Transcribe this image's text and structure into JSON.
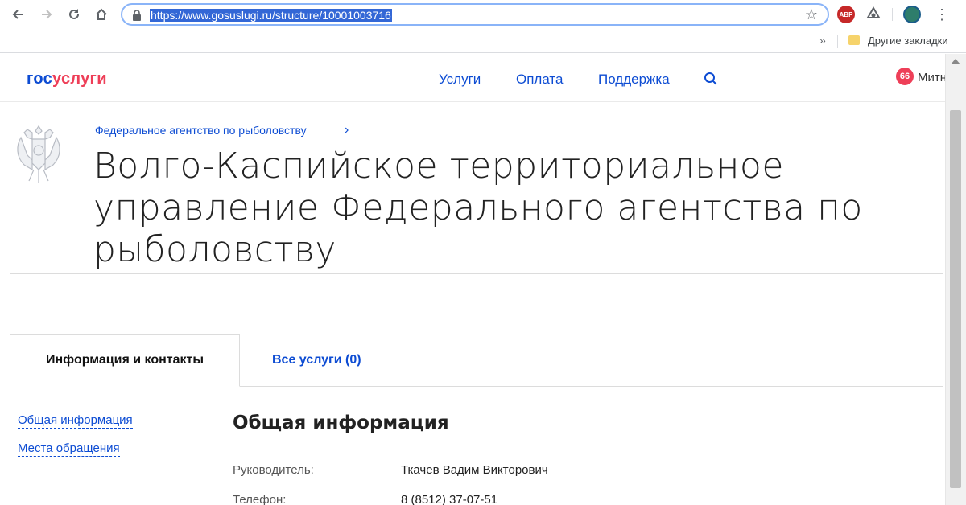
{
  "browser": {
    "url": "https://www.gosuslugi.ru/structure/10001003716",
    "bookmarks_more": "»",
    "bookmark_folder": "Другие закладки",
    "ext_abp": "ABP"
  },
  "header": {
    "logo_part1": "гос",
    "logo_part2": "услуги",
    "nav": [
      "Услуги",
      "Оплата",
      "Поддержка"
    ],
    "notifications": "66",
    "user_name": "Митн"
  },
  "breadcrumb": "Федеральное агентство по рыболовству",
  "title": "Волго-Каспийское территориальное управление Федерального агентства по рыболовству",
  "tabs": {
    "active": "Информация и контакты",
    "other": "Все услуги (0)"
  },
  "side_links": [
    "Общая информация",
    "Места обращения"
  ],
  "section": {
    "title": "Общая информация",
    "fields": [
      {
        "label": "Руководитель:",
        "value": "Ткачев Вадим Викторович"
      },
      {
        "label": "Телефон:",
        "value": "8 (8512) 37-07-51"
      }
    ]
  },
  "colors": {
    "brand_blue": "#0d4cd3",
    "brand_red": "#ee3f58",
    "selection": "#3367d6"
  }
}
